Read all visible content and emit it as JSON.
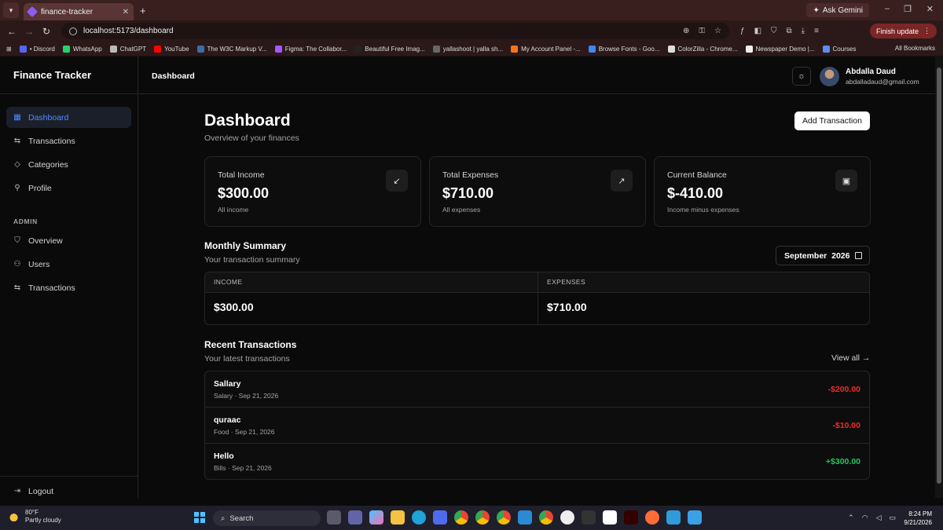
{
  "browser": {
    "tab_title": "finance-tracker",
    "url": "localhost:5173/dashboard",
    "ask_gemini": "Ask Gemini",
    "finish_update": "Finish update",
    "bookmarks": [
      {
        "label": "• Discord",
        "color": "#5865f2"
      },
      {
        "label": "WhatsApp",
        "color": "#25d366"
      },
      {
        "label": "ChatGPT",
        "color": "#bbbbbb"
      },
      {
        "label": "YouTube",
        "color": "#ff0000"
      },
      {
        "label": "The W3C Markup V...",
        "color": "#3a6ea5"
      },
      {
        "label": "Figma: The Collabor...",
        "color": "#a259ff"
      },
      {
        "label": "Beautiful Free Imag...",
        "color": "#222222"
      },
      {
        "label": "yallashoot | yalla sh...",
        "color": "#666666"
      },
      {
        "label": "My Account Panel -...",
        "color": "#f97316"
      },
      {
        "label": "Browse Fonts - Goo...",
        "color": "#4285f4"
      },
      {
        "label": "ColorZilla - Chrome...",
        "color": "#dddddd"
      },
      {
        "label": "Newspaper Demo |...",
        "color": "#eeeeee"
      },
      {
        "label": "Courses",
        "color": "#5b8def"
      }
    ],
    "all_bookmarks": "All Bookmarks"
  },
  "sidebar": {
    "brand": "Finance Tracker",
    "items": [
      {
        "label": "Dashboard",
        "icon": "grid-icon"
      },
      {
        "label": "Transactions",
        "icon": "arrows-icon"
      },
      {
        "label": "Categories",
        "icon": "tag-icon"
      },
      {
        "label": "Profile",
        "icon": "user-icon"
      }
    ],
    "admin_label": "ADMIN",
    "admin_items": [
      {
        "label": "Overview",
        "icon": "shield-icon"
      },
      {
        "label": "Users",
        "icon": "users-icon"
      },
      {
        "label": "Transactions",
        "icon": "arrows-icon"
      }
    ],
    "logout": "Logout"
  },
  "topbar": {
    "breadcrumb": "Dashboard",
    "user_name": "Abdalla Daud",
    "user_email": "abdalladaud@gmail.com"
  },
  "page": {
    "title": "Dashboard",
    "subtitle": "Overview of your finances",
    "add_button": "Add Transaction"
  },
  "cards": [
    {
      "label": "Total Income",
      "value": "$300.00",
      "caption": "All income",
      "icon": "arrow-down-left-icon"
    },
    {
      "label": "Total Expenses",
      "value": "$710.00",
      "caption": "All expenses",
      "icon": "arrow-up-right-icon"
    },
    {
      "label": "Current Balance",
      "value": "$-410.00",
      "caption": "Income minus expenses",
      "icon": "wallet-icon"
    }
  ],
  "monthly": {
    "title": "Monthly Summary",
    "subtitle": "Your transaction summary",
    "month": "September  2026",
    "income_label": "INCOME",
    "income_value": "$300.00",
    "expenses_label": "EXPENSES",
    "expenses_value": "$710.00"
  },
  "recent": {
    "title": "Recent Transactions",
    "subtitle": "Your latest transactions",
    "view_all": "View all →",
    "rows": [
      {
        "title": "Sallary",
        "meta": "Salary · Sep 21, 2026",
        "amount": "-$200.00",
        "sign": "neg"
      },
      {
        "title": "quraac",
        "meta": "Food · Sep 21, 2026",
        "amount": "-$10.00",
        "sign": "neg"
      },
      {
        "title": "Hello",
        "meta": "Bills · Sep 21, 2026",
        "amount": "+$300.00",
        "sign": "pos"
      }
    ]
  },
  "taskbar": {
    "temp": "80°F",
    "weather": "Partly cloudy",
    "search": "Search",
    "time": "8:24 PM",
    "date": "9/21/2026"
  }
}
